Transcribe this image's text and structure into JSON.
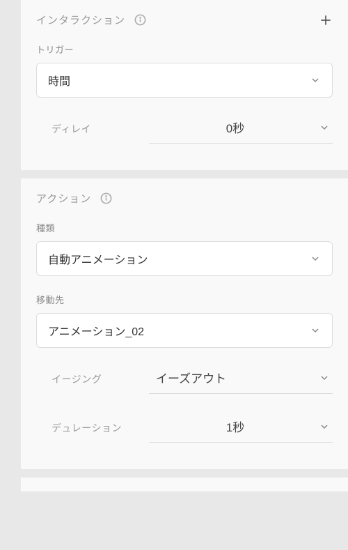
{
  "interaction": {
    "title": "インタラクション",
    "trigger_label": "トリガー",
    "trigger_value": "時間",
    "delay_label": "ディレイ",
    "delay_value": "0秒"
  },
  "action": {
    "title": "アクション",
    "type_label": "種類",
    "type_value": "自動アニメーション",
    "destination_label": "移動先",
    "destination_value": "アニメーション_02",
    "easing_label": "イージング",
    "easing_value": "イーズアウト",
    "duration_label": "デュレーション",
    "duration_value": "1秒"
  }
}
